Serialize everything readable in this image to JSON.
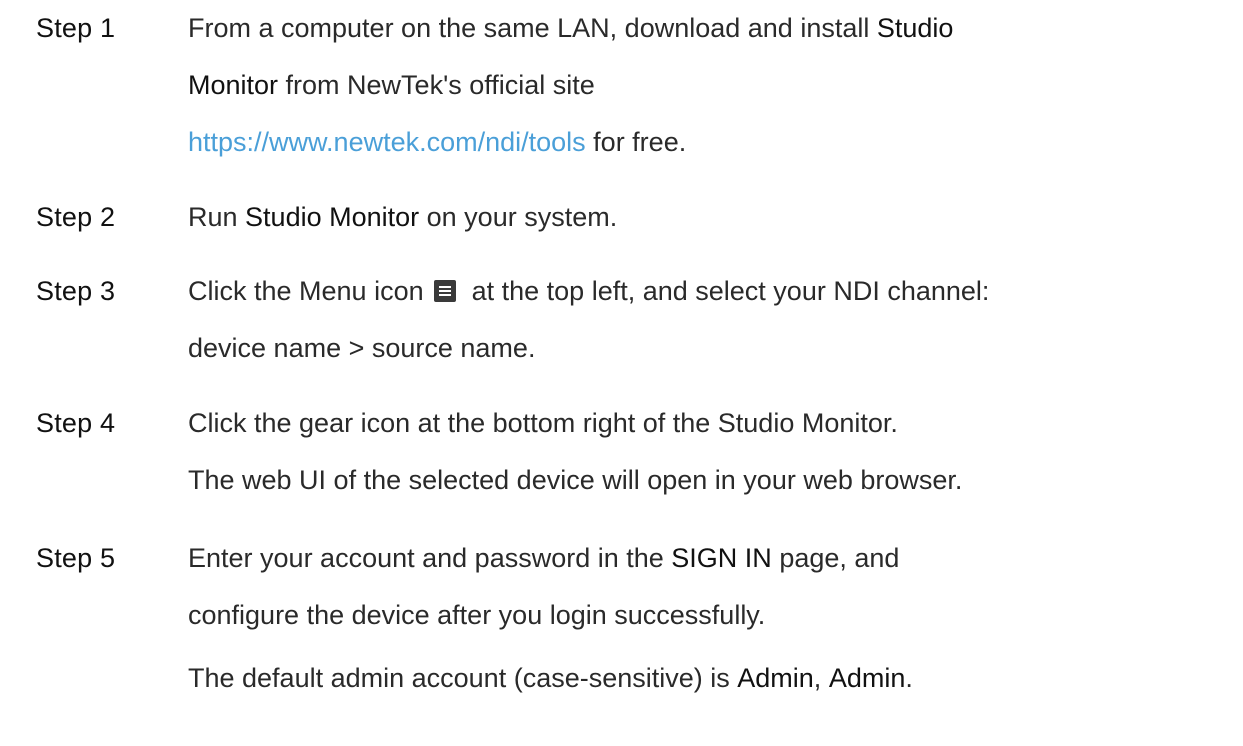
{
  "steps": [
    {
      "label": "Step 1",
      "lines": [
        {
          "t1": "From a computer on the same LAN, download and install ",
          "b1": "Studio"
        },
        {
          "b1": "Monitor",
          "t2": " from NewTek's official site"
        },
        {
          "link": "https://www.newtek.com/ndi/tools",
          "t2": " for free."
        }
      ]
    },
    {
      "label": "Step 2",
      "lines": [
        {
          "t1": "Run ",
          "b1": "Studio Monitor",
          "t2": " on your system."
        }
      ]
    },
    {
      "label": "Step 3",
      "lines": [
        {
          "t1": "Click the Menu icon",
          "t2": "at the top left, and select your NDI channel:"
        },
        {
          "t1": "device name > source name."
        }
      ],
      "icon": "menu-icon"
    },
    {
      "label": "Step 4",
      "lines": [
        {
          "t1": "Click the gear icon at the bottom right of the Studio Monitor."
        },
        {
          "t1": "The web UI of the selected device will open in your web browser."
        }
      ]
    },
    {
      "label": "Step 5",
      "lines": [
        {
          "t1": "Enter your account and password in the ",
          "b1": "SIGN IN",
          "t2": " page, and"
        },
        {
          "t1": "configure the device after you login successfully."
        },
        {
          "t1": "The default admin account (case-sensitive) is ",
          "b1": "Admin",
          "t2": ", ",
          "b2": "Admin",
          "t3": "."
        }
      ]
    }
  ]
}
